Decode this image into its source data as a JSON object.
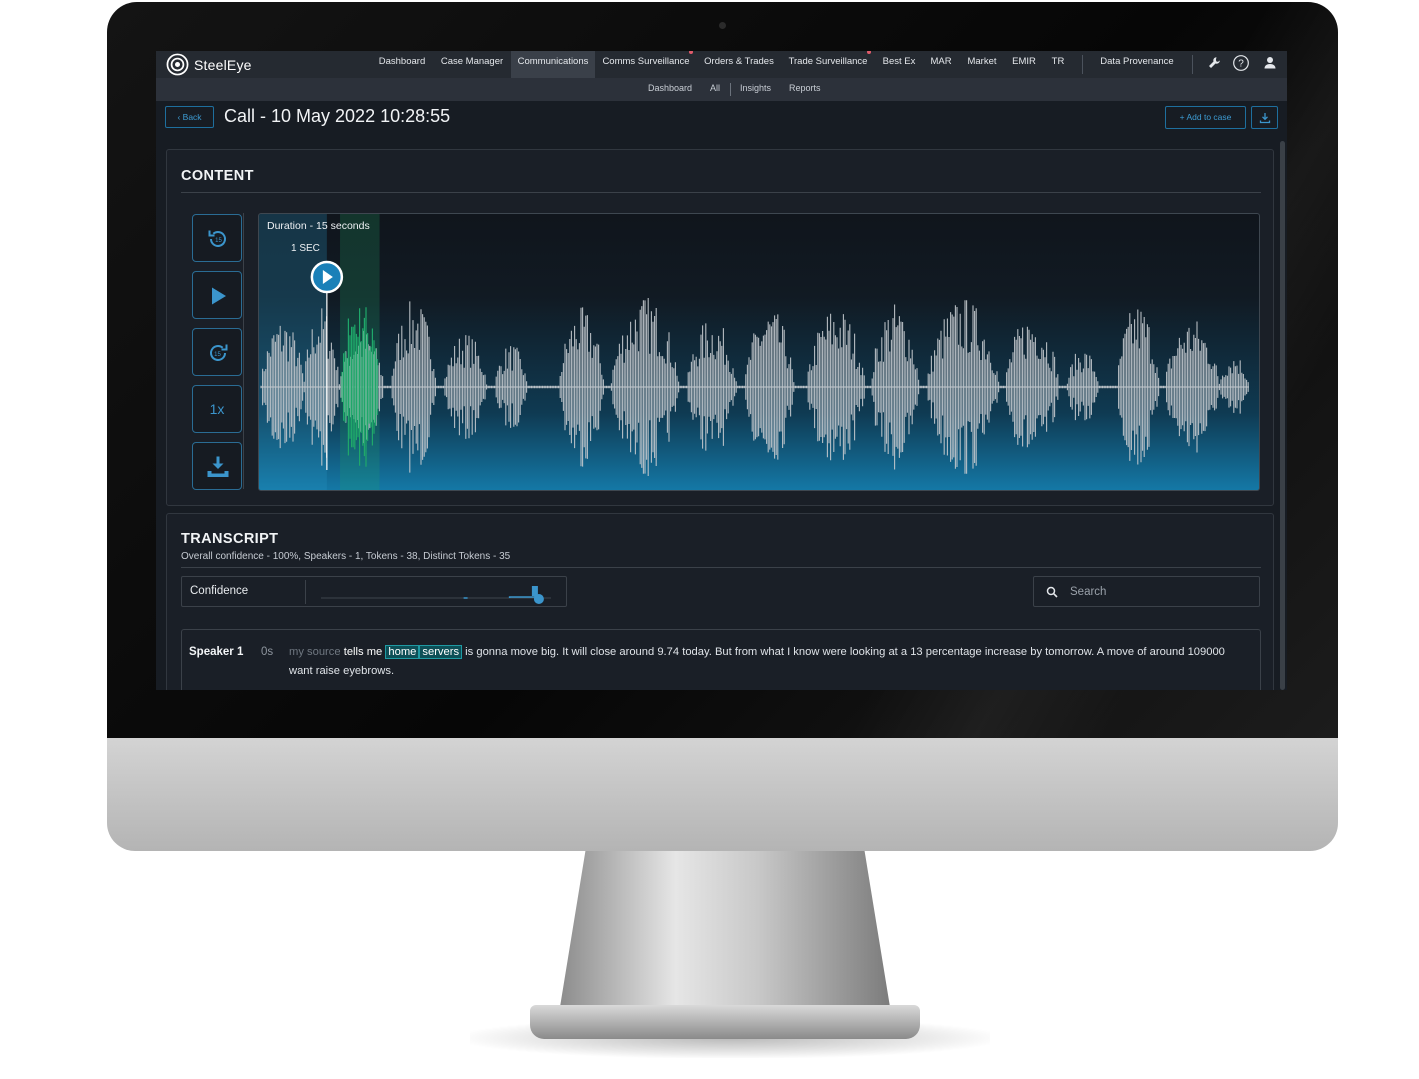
{
  "app": {
    "name": "SteelEye"
  },
  "topnav": {
    "items": [
      {
        "label": "Dashboard"
      },
      {
        "label": "Case Manager"
      },
      {
        "label": "Communications"
      },
      {
        "label": "Comms Surveillance"
      },
      {
        "label": "Orders & Trades"
      },
      {
        "label": "Trade Surveillance"
      },
      {
        "label": "Best Ex"
      },
      {
        "label": "MAR"
      },
      {
        "label": "Market"
      },
      {
        "label": "EMIR"
      },
      {
        "label": "TR"
      },
      {
        "label": "Data Provenance"
      }
    ],
    "active": "Communications",
    "icons": [
      "wrench-icon",
      "help-icon",
      "user-icon"
    ]
  },
  "subnav": {
    "items": [
      {
        "label": "Dashboard"
      },
      {
        "label": "All"
      },
      {
        "label": "Insights"
      },
      {
        "label": "Reports"
      }
    ]
  },
  "header": {
    "back_label": "‹ Back",
    "title": "Call - 10 May 2022 10:28:55",
    "add_to_case_label": "+  Add to case"
  },
  "content": {
    "title": "CONTENT",
    "duration_label": "Duration - 15 seconds",
    "position_label": "1 SEC",
    "playback_speed": "1x",
    "playhead_seconds": 1,
    "duration_seconds": 15,
    "highlight_range_seconds": [
      1.2,
      1.8
    ],
    "controls": [
      "rewind-15-icon",
      "play-icon",
      "forward-15-icon",
      "speed",
      "download-icon"
    ]
  },
  "transcript": {
    "title": "TRANSCRIPT",
    "meta": "Overall confidence - 100%, Speakers - 1, Tokens - 38, Distinct Tokens - 35",
    "confidence_label": "Confidence",
    "confidence_value": 0.93,
    "search_placeholder": "Search",
    "speaker": "Speaker 1",
    "time": "0s",
    "tokens": [
      {
        "text": "my source",
        "style": "low"
      },
      {
        "text": "tells me",
        "style": "hi"
      },
      {
        "text": "home",
        "style": "hl"
      },
      {
        "text": "servers",
        "style": "hl"
      },
      {
        "text": "is gonna move big. It will close around 9.74 today. But from what I know were looking at a 13 percentage increase by tomorrow. A move of around 109000 want raise eyebrows.",
        "style": "normal"
      }
    ]
  },
  "colors": {
    "accent": "#3b95cc",
    "highlight": "#1f9aa3",
    "wave": "#c4c9ce",
    "wave_highlight": "#1fa86a"
  }
}
